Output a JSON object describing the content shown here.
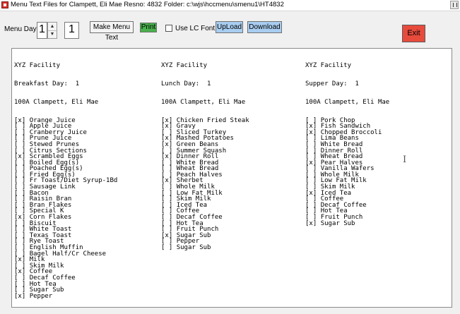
{
  "window": {
    "title": "Menu Text Files for Clampett, Eli Mae Resno: 4832 Folder: c:\\wjs\\hccmenu\\smenu1\\HT4832"
  },
  "toolbar": {
    "menu_days_label": "Menu Days",
    "menu_days_value": "1",
    "day_value": "1",
    "make_menu_text": "Make Menu Text",
    "print": "Print",
    "use_lc_font": "Use LC Font",
    "upload": "UpLoad",
    "download": "Download",
    "exit": "Exit"
  },
  "columns": [
    {
      "facility": "XYZ Facility",
      "meal": "Breakfast Day:  1",
      "resident": "100A Clampett, Eli Mae",
      "items": [
        {
          "mark": "[x]",
          "name": "Orange Juice"
        },
        {
          "mark": "[ ]",
          "name": "Apple Juice"
        },
        {
          "mark": "[ ]",
          "name": "Cranberry Juice"
        },
        {
          "mark": "[ ]",
          "name": "Prune Juice"
        },
        {
          "mark": "[ ]",
          "name": "Stewed Prunes"
        },
        {
          "mark": "[ ]",
          "name": "Citrus Sections"
        },
        {
          "mark": "[x]",
          "name": "Scrambled Eggs"
        },
        {
          "mark": "[ ]",
          "name": "Boiled Egg(s)"
        },
        {
          "mark": "[ ]",
          "name": "Poached Egg(s)"
        },
        {
          "mark": "[ ]",
          "name": "Fried Egg(s)"
        },
        {
          "mark": "[ ]",
          "name": "Fr Toast/Diet Syrup-1Bd"
        },
        {
          "mark": "[ ]",
          "name": "Sausage Link"
        },
        {
          "mark": "[ ]",
          "name": "Bacon"
        },
        {
          "mark": "[ ]",
          "name": "Raisin Bran"
        },
        {
          "mark": "[ ]",
          "name": "Bran Flakes"
        },
        {
          "mark": "[ ]",
          "name": "Special K"
        },
        {
          "mark": "[x]",
          "name": "Corn Flakes"
        },
        {
          "mark": "[ ]",
          "name": "Biscuit"
        },
        {
          "mark": "[ ]",
          "name": "White Toast"
        },
        {
          "mark": "[ ]",
          "name": "Texas Toast"
        },
        {
          "mark": "[ ]",
          "name": "Rye Toast"
        },
        {
          "mark": "[ ]",
          "name": "English Muffin"
        },
        {
          "mark": "[ ]",
          "name": "Bagel Half/Cr Cheese"
        },
        {
          "mark": "[x]",
          "name": "Milk"
        },
        {
          "mark": "[ ]",
          "name": "Skim Milk"
        },
        {
          "mark": "[x]",
          "name": "Coffee"
        },
        {
          "mark": "[ ]",
          "name": "Decaf Coffee"
        },
        {
          "mark": "[ ]",
          "name": "Hot Tea"
        },
        {
          "mark": "[ ]",
          "name": "Sugar Sub"
        },
        {
          "mark": "[x]",
          "name": "Pepper"
        }
      ]
    },
    {
      "facility": "XYZ Facility",
      "meal": "Lunch Day:  1",
      "resident": "100A Clampett, Eli Mae",
      "items": [
        {
          "mark": "[x]",
          "name": "Chicken Fried Steak"
        },
        {
          "mark": "[x]",
          "name": "Gravy"
        },
        {
          "mark": "[ ]",
          "name": "Sliced Turkey"
        },
        {
          "mark": "[x]",
          "name": "Mashed Potatoes"
        },
        {
          "mark": "[x]",
          "name": "Green Beans"
        },
        {
          "mark": "[ ]",
          "name": "Summer Squash"
        },
        {
          "mark": "[x]",
          "name": "Dinner Roll"
        },
        {
          "mark": "[ ]",
          "name": "White Bread"
        },
        {
          "mark": "[ ]",
          "name": "Wheat Bread"
        },
        {
          "mark": "[ ]",
          "name": "Peach Halves"
        },
        {
          "mark": "[x]",
          "name": "Sherbet"
        },
        {
          "mark": "[ ]",
          "name": "Whole Milk"
        },
        {
          "mark": "[ ]",
          "name": "Low Fat Milk"
        },
        {
          "mark": "[ ]",
          "name": "Skim Milk"
        },
        {
          "mark": "[ ]",
          "name": "Iced Tea"
        },
        {
          "mark": "[ ]",
          "name": "Coffee"
        },
        {
          "mark": "[ ]",
          "name": "Decaf Coffee"
        },
        {
          "mark": "[ ]",
          "name": "Hot Tea"
        },
        {
          "mark": "[ ]",
          "name": "Fruit Punch"
        },
        {
          "mark": "[x]",
          "name": "Sugar Sub"
        },
        {
          "mark": "[ ]",
          "name": "Pepper"
        },
        {
          "mark": "[ ]",
          "name": "Sugar Sub"
        }
      ]
    },
    {
      "facility": "XYZ Facility",
      "meal": "Supper Day:  1",
      "resident": "100A Clampett, Eli Mae",
      "items": [
        {
          "mark": "[ ]",
          "name": "Pork Chop"
        },
        {
          "mark": "[x]",
          "name": "Fish Sandwich"
        },
        {
          "mark": "[x]",
          "name": "Chopped Broccoli"
        },
        {
          "mark": "[ ]",
          "name": "Lima Beans"
        },
        {
          "mark": "[ ]",
          "name": "White Bread"
        },
        {
          "mark": "[ ]",
          "name": "Dinner Roll"
        },
        {
          "mark": "[ ]",
          "name": "Wheat Bread"
        },
        {
          "mark": "[x]",
          "name": "Pear Halves"
        },
        {
          "mark": "[ ]",
          "name": "Vanilla Wafers"
        },
        {
          "mark": "[ ]",
          "name": "Whole Milk"
        },
        {
          "mark": "[ ]",
          "name": "Low Fat Milk"
        },
        {
          "mark": "[ ]",
          "name": "Skim Milk"
        },
        {
          "mark": "[x]",
          "name": "Iced Tea"
        },
        {
          "mark": "[ ]",
          "name": "Coffee"
        },
        {
          "mark": "[ ]",
          "name": "Decaf Coffee"
        },
        {
          "mark": "[ ]",
          "name": "Hot Tea"
        },
        {
          "mark": "[ ]",
          "name": "Fruit Punch"
        },
        {
          "mark": "[x]",
          "name": "Sugar Sub"
        }
      ]
    }
  ]
}
